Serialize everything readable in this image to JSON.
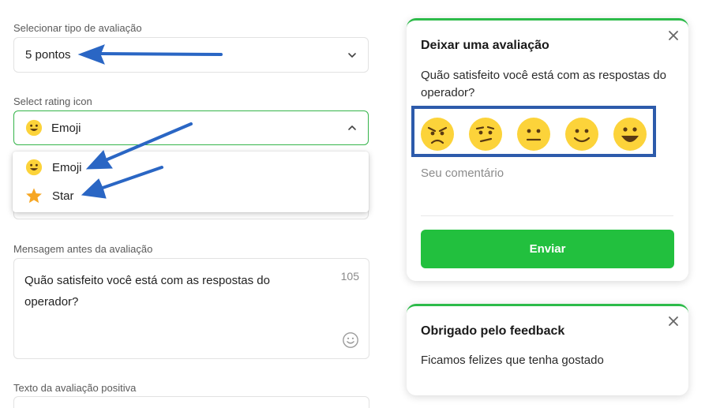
{
  "rating_type": {
    "label": "Selecionar tipo de avaliação",
    "value": "5 pontos"
  },
  "rating_icon": {
    "label": "Select rating icon",
    "value": "Emoji",
    "options": [
      {
        "label": "Emoji",
        "icon": "emoji-face-icon"
      },
      {
        "label": "Star",
        "icon": "star-icon"
      }
    ]
  },
  "message_before": {
    "label": "Mensagem antes da avaliação",
    "value": "Quão satisfeito você está com as respostas do operador?",
    "char_count": "105"
  },
  "positive_text": {
    "label": "Texto da avaliação positiva"
  },
  "preview_rating": {
    "title": "Deixar uma avaliação",
    "question": "Quão satisfeito você está com as respostas do operador?",
    "faces": [
      "angry-face-icon",
      "confused-face-icon",
      "neutral-face-icon",
      "smiling-face-icon",
      "grinning-face-icon"
    ],
    "comment_placeholder": "Seu comentário",
    "submit_label": "Enviar"
  },
  "preview_thanks": {
    "title": "Obrigado pelo feedback",
    "message": "Ficamos felizes que tenha gostado"
  },
  "colors": {
    "accent_green": "#22c03e",
    "highlight_box": "#2d5bab",
    "arrow_blue": "#2a66c4",
    "emoji_yellow": "#fcd33a"
  }
}
